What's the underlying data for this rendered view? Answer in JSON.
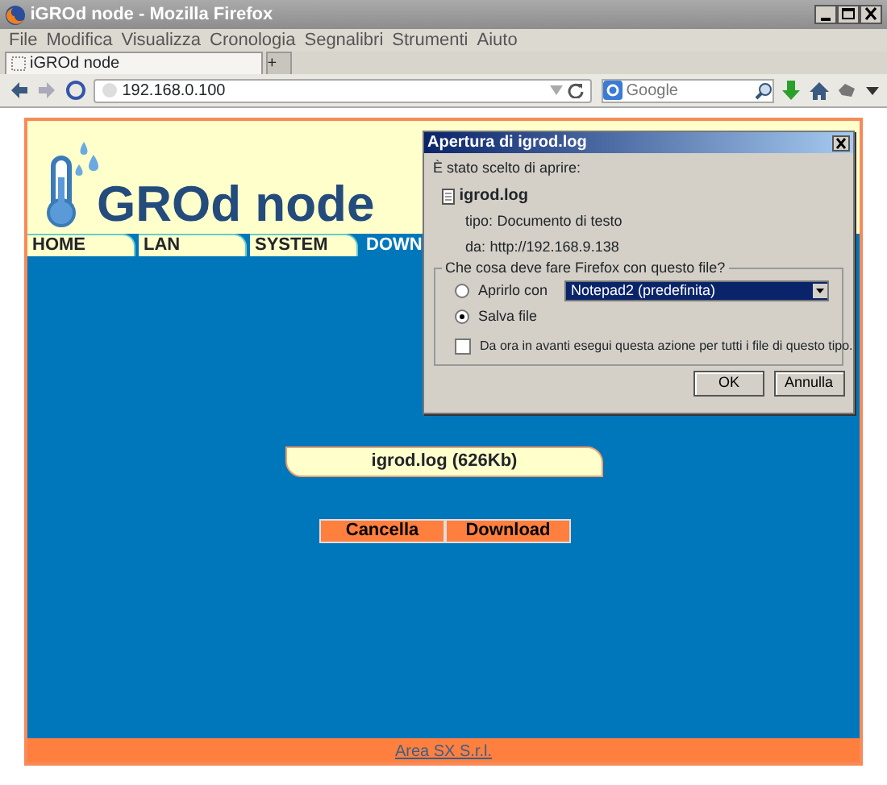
{
  "window": {
    "title": "iGROd node - Mozilla Firefox"
  },
  "menu": [
    "File",
    "Modifica",
    "Visualizza",
    "Cronologia",
    "Segnalibri",
    "Strumenti",
    "Aiuto"
  ],
  "browser_tabs": [
    {
      "label": "iGROd node",
      "selected": true
    },
    {
      "label": "+",
      "selected": false
    }
  ],
  "address_bar": {
    "value": "192.168.0.100"
  },
  "search": {
    "placeholder": "Google"
  },
  "site": {
    "logo": "GROd node",
    "nav": [
      {
        "label": "HOME",
        "selected": false
      },
      {
        "label": "LAN",
        "selected": false
      },
      {
        "label": "SYSTEM",
        "selected": false
      },
      {
        "label": "DOWN",
        "selected": true
      }
    ],
    "file_label": "igrod.log (626Kb)",
    "buttons": [
      "Cancella",
      "Download"
    ],
    "footer_link": "Area SX S.r.l."
  },
  "dialog": {
    "title": "Apertura di igrod.log",
    "intro": "È stato scelto di aprire:",
    "file_name": "igrod.log",
    "type_label": "tipo:",
    "type_value": "Documento di testo",
    "from_label": "da:",
    "from_value": "http://192.168.9.138",
    "group_label": "Che cosa deve fare Firefox con questo file?",
    "options": [
      {
        "label": "Aprirlo con",
        "selected": false
      },
      {
        "label": "Salva file",
        "selected": true
      }
    ],
    "app_select": "Notepad2 (predefinita)",
    "remember": {
      "label": "Da ora in avanti esegui questa azione per tutti i file di questo tipo.",
      "checked": false
    },
    "buttons": [
      "OK",
      "Annulla"
    ]
  }
}
